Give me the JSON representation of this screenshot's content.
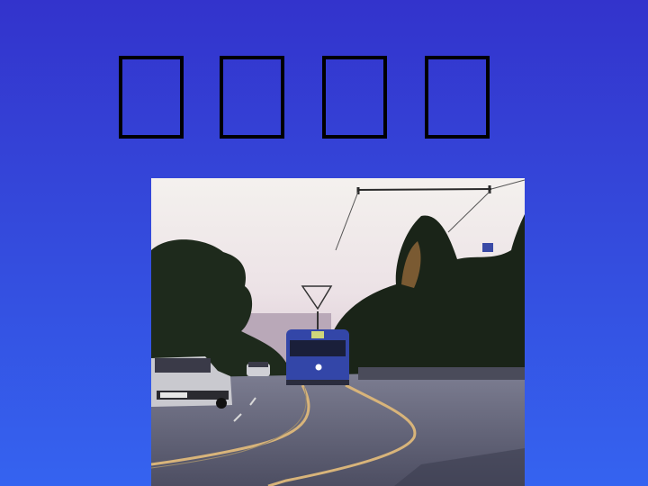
{
  "slide": {
    "title_glyphs": [
      "□",
      "□",
      "□",
      "□"
    ],
    "background_colors": [
      "#3333cc",
      "#3563f0"
    ]
  },
  "photo": {
    "subject": "tram-street-dusk"
  }
}
